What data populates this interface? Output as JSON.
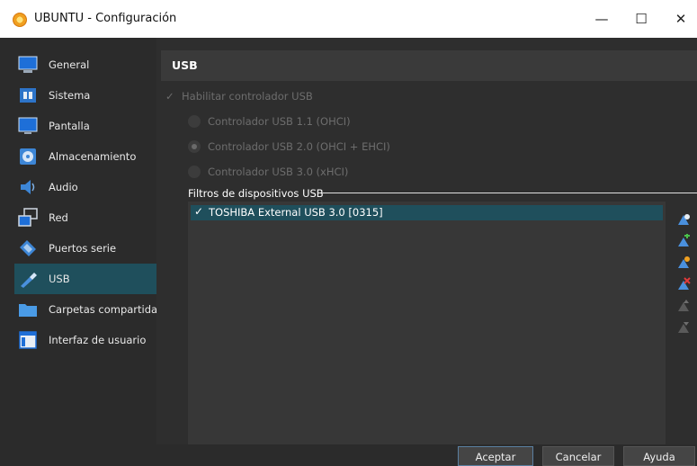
{
  "window": {
    "title": "UBUNTU - Configuración",
    "minimize_glyph": "—",
    "maximize_glyph": "☐",
    "close_glyph": "✕"
  },
  "sidebar": {
    "items": [
      {
        "label": "General",
        "icon": "monitor-general-icon"
      },
      {
        "label": "Sistema",
        "icon": "chip-icon"
      },
      {
        "label": "Pantalla",
        "icon": "display-icon"
      },
      {
        "label": "Almacenamiento",
        "icon": "disk-icon"
      },
      {
        "label": "Audio",
        "icon": "speaker-icon"
      },
      {
        "label": "Red",
        "icon": "network-icon"
      },
      {
        "label": "Puertos serie",
        "icon": "serial-port-icon"
      },
      {
        "label": "USB",
        "icon": "usb-icon",
        "selected": true
      },
      {
        "label": "Carpetas compartidas",
        "icon": "folder-icon"
      },
      {
        "label": "Interfaz de usuario",
        "icon": "window-icon"
      }
    ]
  },
  "main": {
    "title": "USB",
    "enable_label": "Habilitar controlador USB",
    "enable_check": "✓",
    "controllers": [
      {
        "label": "Controlador USB 1.1 (OHCI)",
        "selected": false
      },
      {
        "label": "Controlador USB 2.0 (OHCI + EHCI)",
        "selected": true
      },
      {
        "label": "Controlador USB 3.0 (xHCI)",
        "selected": false
      }
    ],
    "filters_label": "Filtros de dispositivos USB",
    "filters": [
      {
        "label": "TOSHIBA External USB 3.0 [0315]",
        "check": "✓"
      }
    ],
    "tools": [
      {
        "icon": "usb-filter-new-icon",
        "enabled": true
      },
      {
        "icon": "usb-filter-add-icon",
        "enabled": true
      },
      {
        "icon": "usb-filter-edit-icon",
        "enabled": true
      },
      {
        "icon": "usb-filter-remove-icon",
        "enabled": true
      },
      {
        "icon": "usb-filter-up-icon",
        "enabled": false
      },
      {
        "icon": "usb-filter-down-icon",
        "enabled": false
      }
    ]
  },
  "footer": {
    "ok_label": "Aceptar",
    "cancel_label": "Cancelar",
    "help_label": "Ayuda"
  },
  "colors": {
    "accent": "#1f4f5c",
    "background": "#2b2b2b",
    "panel": "#2e2e2e",
    "disabled_text": "#6d6d6d"
  }
}
